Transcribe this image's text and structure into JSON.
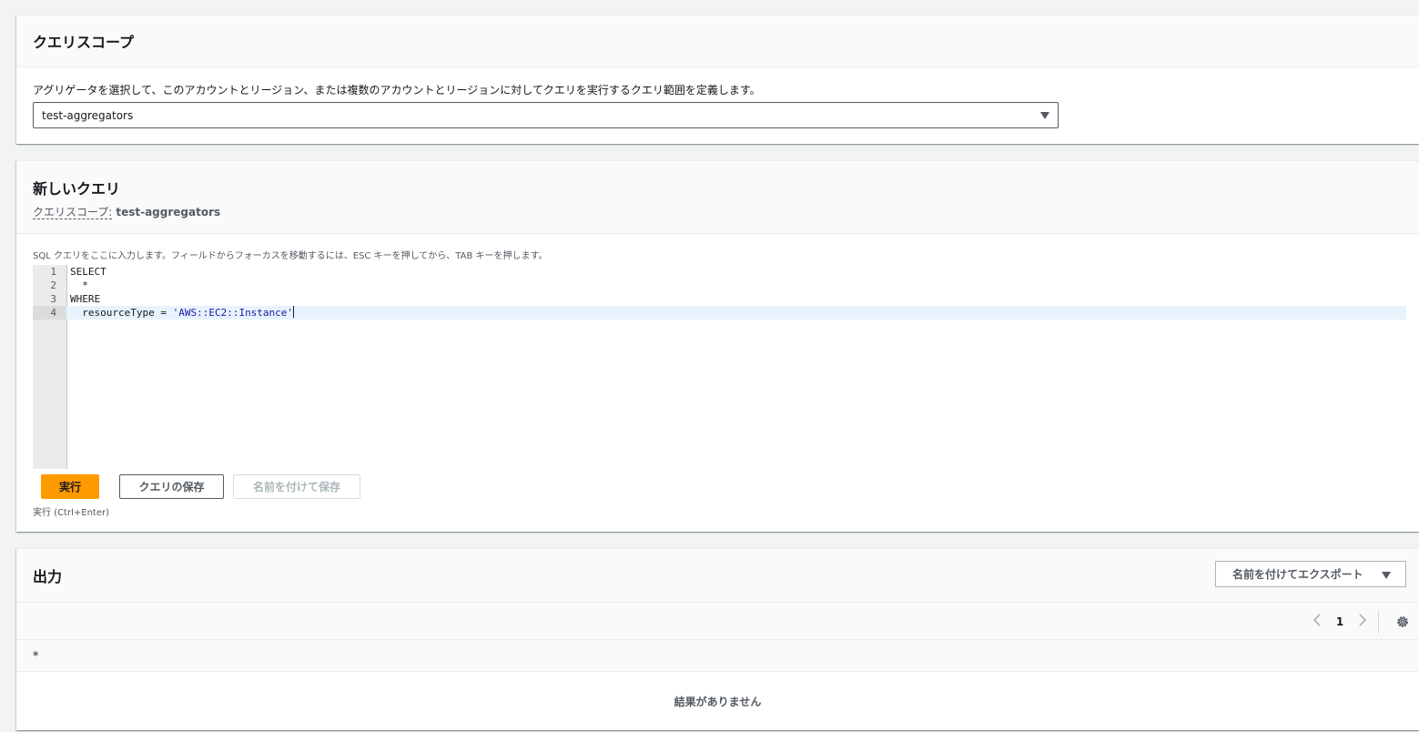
{
  "scope_panel": {
    "title": "クエリスコープ",
    "description": "アグリゲータを選択して、このアカウントとリージョン、または複数のアカウントとリージョンに対してクエリを実行するクエリ範囲を定義します。",
    "selected_aggregator": "test-aggregators"
  },
  "query_panel": {
    "title": "新しいクエリ",
    "scope_label": "クエリスコープ:",
    "scope_value": "test-aggregators",
    "editor_hint": "SQL クエリをここに入力します。フィールドからフォーカスを移動するには、ESC キーを押してから、TAB キーを押します。",
    "lines": [
      {
        "num": "1",
        "text": "SELECT"
      },
      {
        "num": "2",
        "text": "  *"
      },
      {
        "num": "3",
        "text": "WHERE"
      },
      {
        "num": "4",
        "text_prefix": "  resourceType = ",
        "text_string": "'AWS::EC2::Instance'"
      }
    ],
    "run_label": "実行",
    "save_label": "クエリの保存",
    "save_as_label": "名前を付けて保存",
    "run_hint": "実行 (Ctrl+Enter)"
  },
  "output_panel": {
    "title": "出力",
    "export_label": "名前を付けてエクスポート",
    "current_page": "1",
    "column_header": "*",
    "empty_message": "結果がありません"
  },
  "colors": {
    "primary_button": "#ff9900",
    "keyword": "#7a0b4d",
    "string": "#1a1aa6",
    "active_line": "#e8f2fc"
  },
  "icons": {
    "select_caret": "caret-down-icon",
    "export_caret": "caret-down-icon",
    "prev": "chevron-left-icon",
    "next": "chevron-right-icon",
    "settings": "gear-icon"
  }
}
